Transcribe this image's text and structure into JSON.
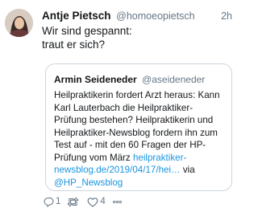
{
  "tweet": {
    "author": {
      "name": "Antje Pietsch",
      "handle": "@homoeopietsch"
    },
    "timestamp": "2h",
    "text": "Wir sind gespannt:\ntraut er sich?",
    "quoted": {
      "author": {
        "name": "Armin Seideneder",
        "handle": "@aseideneder"
      },
      "text_before": "Heilpraktikerin fordert Arzt heraus: Kann Karl Lauterbach die Heilpraktiker-Prüfung bestehen? Heilpraktikerin und Heilpraktiker-Newsblog fordern ihn zum Test auf - mit den 60 Fragen der HP-Prüfung vom März ",
      "link": "heilpraktiker-newsblog.de/2019/04/17/hei…",
      "via_text": " via ",
      "via_mention": "@HP_Newsblog"
    },
    "actions": {
      "reply_count": "1",
      "retweet_count": "",
      "like_count": "4"
    }
  },
  "icons": {
    "reply": "reply-icon",
    "retweet": "retweet-icon",
    "like": "heart-icon",
    "more": "more-icon"
  },
  "colors": {
    "link": "#1b95e0",
    "secondary_text": "#657786",
    "border": "#ccd6dd",
    "primary_text": "#14171a"
  }
}
